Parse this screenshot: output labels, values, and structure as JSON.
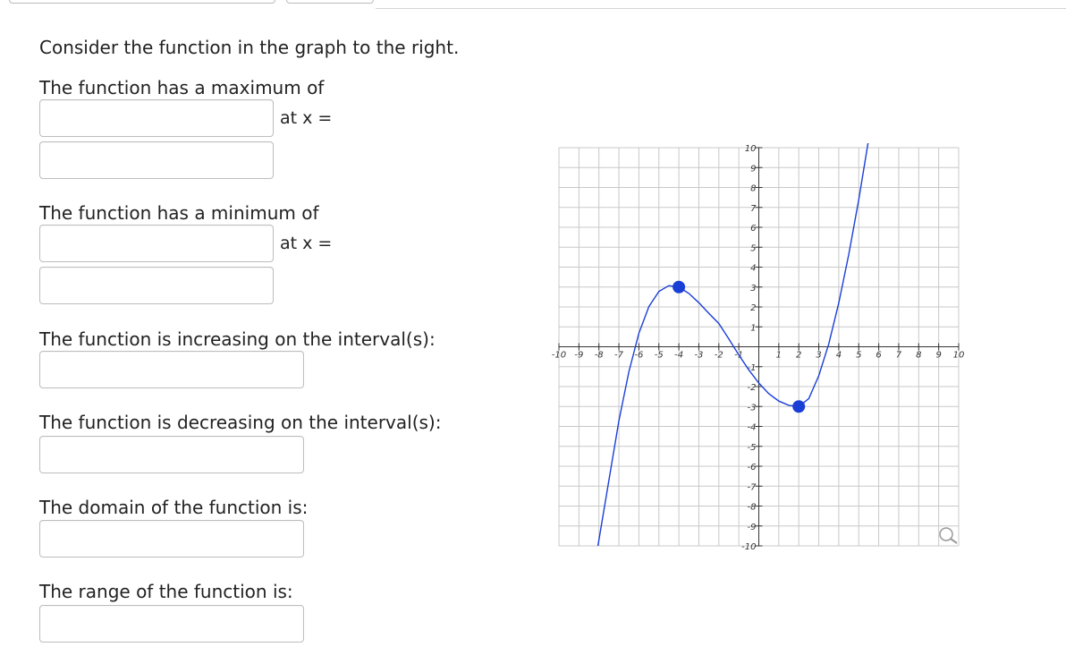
{
  "questions": {
    "intro": "Consider the function in the graph to the right.",
    "max_label": "The function has a maximum of",
    "min_label": "The function has a minimum of",
    "at_x": "at x =",
    "increasing_label": "The function is increasing on the interval(s):",
    "decreasing_label": "The function is decreasing on the interval(s):",
    "domain_label": "The domain of the function is:",
    "range_label": "The range of the function is:"
  },
  "inputs": {
    "max_value": "",
    "max_x": "",
    "min_value": "",
    "min_x": "",
    "increasing": "",
    "decreasing": "",
    "domain": "",
    "range": ""
  },
  "graph": {
    "x_ticks": [
      "-10",
      "-9",
      "-8",
      "-7",
      "-6",
      "-5",
      "-4",
      "-3",
      "-2",
      "-1",
      "1",
      "2",
      "3",
      "4",
      "5",
      "6",
      "7",
      "8",
      "9",
      "10"
    ],
    "y_ticks": [
      "10",
      "9",
      "8",
      "7",
      "6",
      "5",
      "4",
      "3",
      "2",
      "1",
      "-1",
      "-2",
      "-3",
      "-4",
      "-5",
      "-6",
      "-7",
      "-8",
      "-9",
      "-10"
    ],
    "curve_color": "#1a3fd6",
    "point_color": "#1a3fd6",
    "grid_color": "#c8c8c8",
    "icons": {
      "zoom": "magnifier-icon"
    }
  },
  "chart_data": {
    "type": "line",
    "xlim": [
      -10,
      10
    ],
    "ylim": [
      -10,
      10
    ],
    "grid": true,
    "series": [
      {
        "x": [
          -8.05,
          -7.5,
          -7,
          -6.5,
          -6,
          -5.5,
          -5,
          -4.5,
          -4,
          -3.5,
          -3,
          -2.5,
          -2,
          -1.5,
          -1,
          -0.5,
          0,
          0.5,
          1,
          1.5,
          2,
          2.5,
          3,
          3.5,
          4,
          4.5,
          5,
          5.5,
          6,
          6.5,
          6.75
        ],
        "y": [
          -10,
          -6.7,
          -3.73,
          -1.26,
          0.68,
          2.02,
          2.78,
          3.07,
          3.0,
          2.68,
          2.21,
          1.68,
          1.17,
          0.39,
          -0.41,
          -1.16,
          -1.82,
          -2.36,
          -2.73,
          -2.94,
          -3.0,
          -2.6,
          -1.46,
          0.14,
          2.2,
          4.64,
          7.4,
          10.44,
          13.7,
          17.14,
          19.0
        ]
      }
    ],
    "points": [
      {
        "x": -4,
        "y": 3
      },
      {
        "x": 2,
        "y": -3
      }
    ]
  }
}
